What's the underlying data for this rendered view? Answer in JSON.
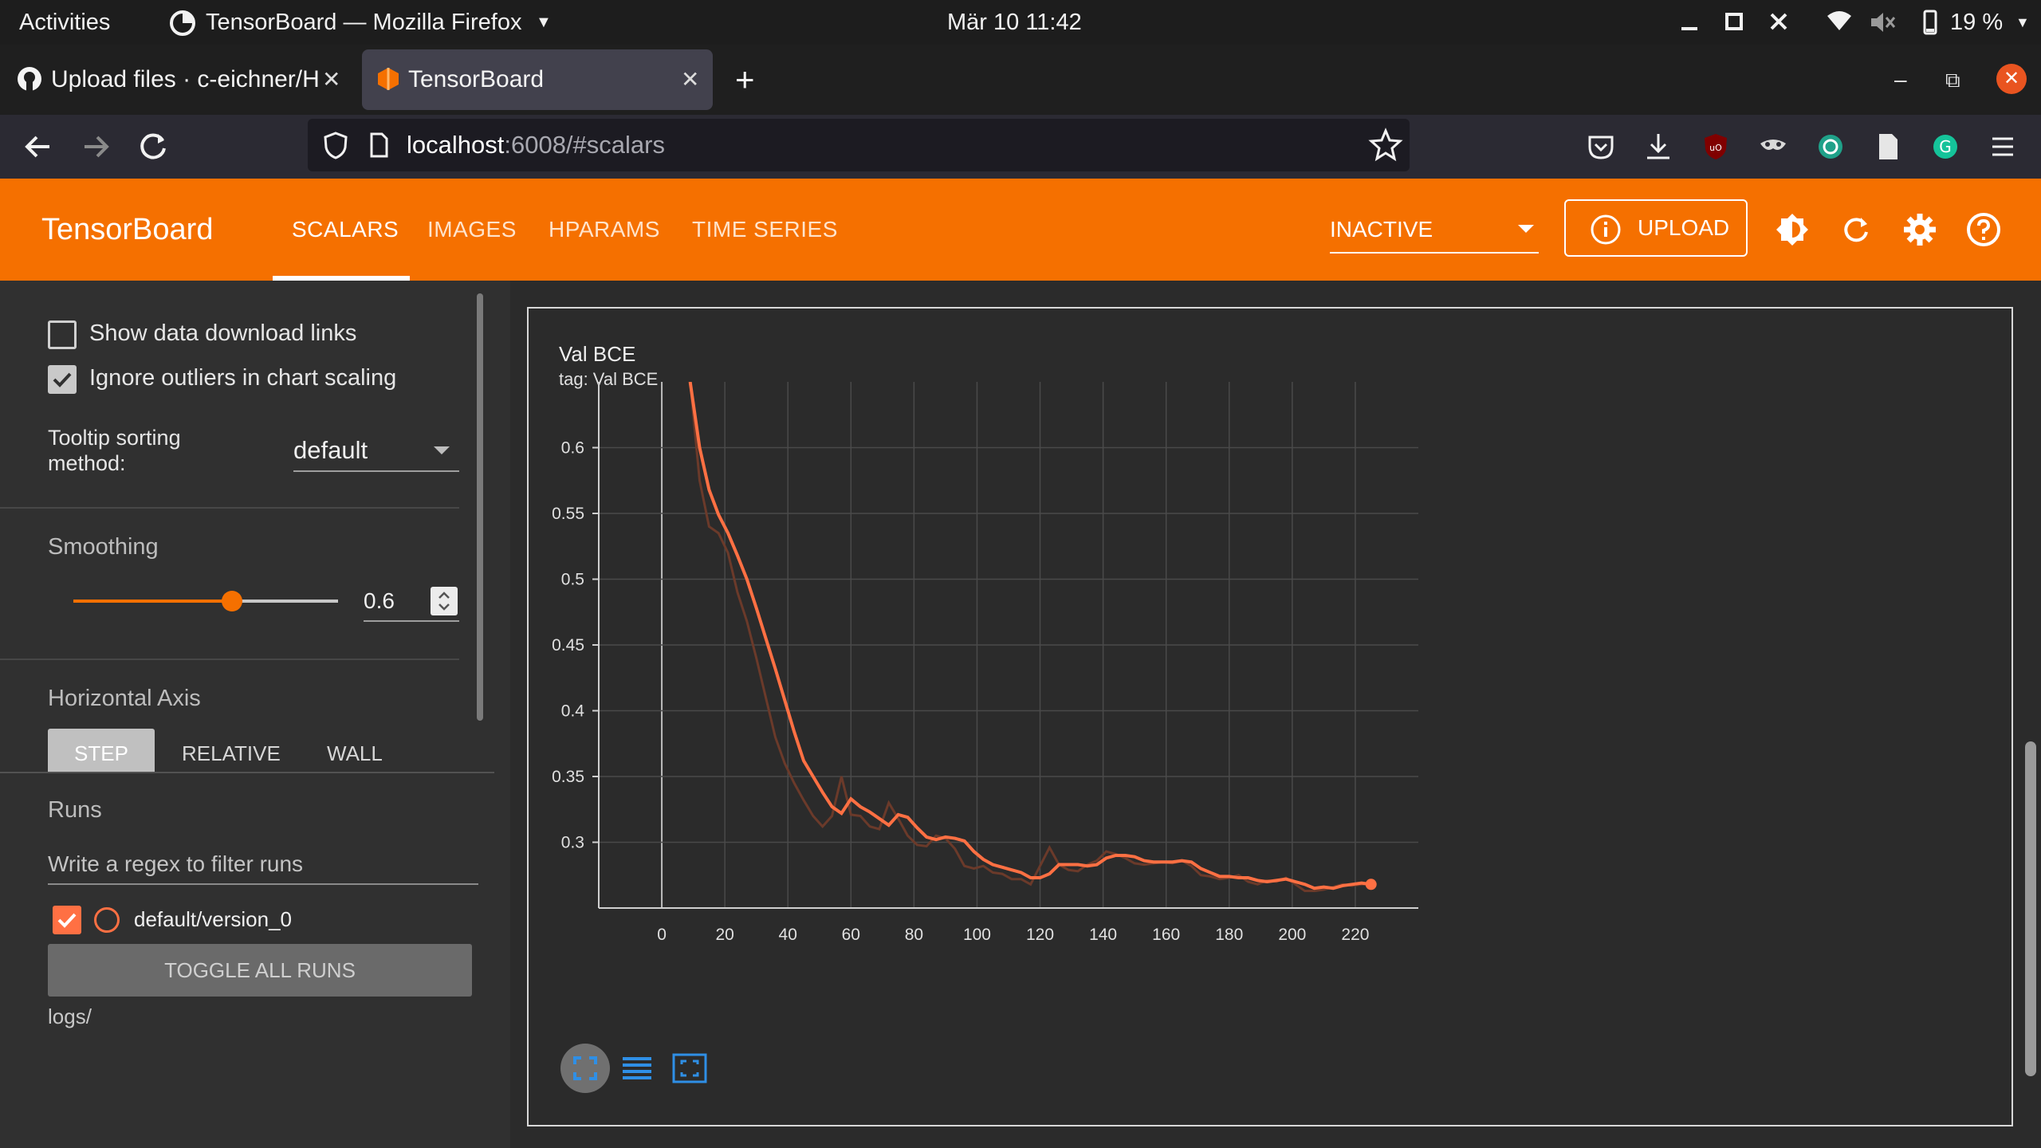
{
  "os_bar": {
    "activities": "Activities",
    "app_title": "TensorBoard — Mozilla Firefox",
    "clock": "Mär 10  11:42",
    "battery": "19 %"
  },
  "browser": {
    "tabs": [
      {
        "label": "Upload files · c-eichner/H"
      },
      {
        "label": "TensorBoard"
      }
    ],
    "url_host": "localhost",
    "url_rest": ":6008/#scalars"
  },
  "tensorboard": {
    "brand": "TensorBoard",
    "tabs": [
      "SCALARS",
      "IMAGES",
      "HPARAMS",
      "TIME SERIES"
    ],
    "status_select": "INACTIVE",
    "upload_label": "UPLOAD"
  },
  "sidebar": {
    "show_download_links": "Show data download links",
    "ignore_outliers": "Ignore outliers in chart scaling",
    "tooltip_label_1": "Tooltip sorting",
    "tooltip_label_2": "method:",
    "tooltip_value": "default",
    "smoothing_label": "Smoothing",
    "smoothing_value": "0.6",
    "smoothing_fraction": 0.6,
    "horizontal_axis_label": "Horizontal Axis",
    "axis_options": [
      "STEP",
      "RELATIVE",
      "WALL"
    ],
    "runs_label": "Runs",
    "runs_filter_placeholder": "Write a regex to filter runs",
    "run_name": "default/version_0",
    "toggle_all": "TOGGLE ALL RUNS",
    "logdir": "logs/"
  },
  "colors": {
    "accent": "#f57000",
    "series": "#ff7043",
    "series_raw": "#6b3a2a"
  },
  "chart_data": {
    "type": "line",
    "title": "Val BCE",
    "subtitle": "tag: Val BCE",
    "xlabel": "",
    "ylabel": "",
    "xlim": [
      -20,
      240
    ],
    "ylim": [
      0.25,
      0.65
    ],
    "xticks": [
      0,
      20,
      40,
      60,
      80,
      100,
      120,
      140,
      160,
      180,
      200,
      220
    ],
    "yticks": [
      0.3,
      0.35,
      0.4,
      0.45,
      0.5,
      0.55,
      0.6
    ],
    "grid": true,
    "series": [
      {
        "name": "default/version_0",
        "kind": "smoothed",
        "x": [
          9,
          12,
          15,
          18,
          21,
          24,
          27,
          30,
          33,
          36,
          39,
          42,
          45,
          48,
          51,
          54,
          57,
          60,
          63,
          66,
          69,
          72,
          75,
          78,
          81,
          84,
          87,
          90,
          93,
          96,
          99,
          102,
          105,
          108,
          111,
          114,
          117,
          120,
          123,
          126,
          129,
          132,
          135,
          138,
          141,
          144,
          147,
          150,
          153,
          156,
          159,
          162,
          165,
          168,
          171,
          174,
          177,
          180,
          183,
          186,
          189,
          192,
          195,
          198,
          201,
          204,
          207,
          210,
          213,
          216,
          219,
          222,
          225
        ],
        "y": [
          0.65,
          0.6,
          0.568,
          0.549,
          0.535,
          0.518,
          0.5,
          0.478,
          0.455,
          0.432,
          0.408,
          0.384,
          0.362,
          0.35,
          0.338,
          0.327,
          0.322,
          0.333,
          0.327,
          0.323,
          0.318,
          0.313,
          0.321,
          0.319,
          0.311,
          0.304,
          0.302,
          0.304,
          0.303,
          0.301,
          0.293,
          0.287,
          0.283,
          0.281,
          0.279,
          0.277,
          0.273,
          0.273,
          0.276,
          0.283,
          0.283,
          0.283,
          0.282,
          0.283,
          0.288,
          0.29,
          0.29,
          0.289,
          0.286,
          0.285,
          0.285,
          0.285,
          0.286,
          0.285,
          0.28,
          0.277,
          0.274,
          0.274,
          0.273,
          0.273,
          0.271,
          0.27,
          0.271,
          0.272,
          0.27,
          0.268,
          0.265,
          0.266,
          0.265,
          0.267,
          0.268,
          0.269,
          0.268
        ]
      },
      {
        "name": "default/version_0 (raw)",
        "kind": "raw",
        "x": [
          9,
          12,
          15,
          18,
          21,
          24,
          27,
          30,
          33,
          36,
          39,
          42,
          45,
          48,
          51,
          54,
          57,
          60,
          63,
          66,
          69,
          72,
          75,
          78,
          81,
          84,
          87,
          90,
          93,
          96,
          99,
          102,
          105,
          108,
          111,
          114,
          117,
          120,
          123,
          126,
          129,
          132,
          135,
          138,
          141,
          144,
          147,
          150,
          153,
          156,
          159,
          162,
          165,
          168,
          171,
          174,
          177,
          180,
          183,
          186,
          189,
          192,
          195,
          198,
          201,
          204,
          207,
          210,
          213,
          216,
          219,
          222,
          225
        ],
        "y": [
          0.65,
          0.575,
          0.54,
          0.535,
          0.52,
          0.49,
          0.468,
          0.44,
          0.41,
          0.38,
          0.36,
          0.345,
          0.332,
          0.32,
          0.312,
          0.32,
          0.35,
          0.321,
          0.32,
          0.312,
          0.31,
          0.33,
          0.318,
          0.305,
          0.298,
          0.297,
          0.305,
          0.303,
          0.295,
          0.282,
          0.28,
          0.282,
          0.277,
          0.276,
          0.272,
          0.272,
          0.268,
          0.282,
          0.296,
          0.283,
          0.279,
          0.278,
          0.283,
          0.286,
          0.293,
          0.291,
          0.288,
          0.284,
          0.283,
          0.284,
          0.285,
          0.284,
          0.286,
          0.282,
          0.275,
          0.274,
          0.272,
          0.273,
          0.275,
          0.27,
          0.268,
          0.271,
          0.27,
          0.273,
          0.268,
          0.263,
          0.263,
          0.264,
          0.266,
          0.268,
          0.267,
          0.268,
          0.268
        ]
      }
    ]
  }
}
